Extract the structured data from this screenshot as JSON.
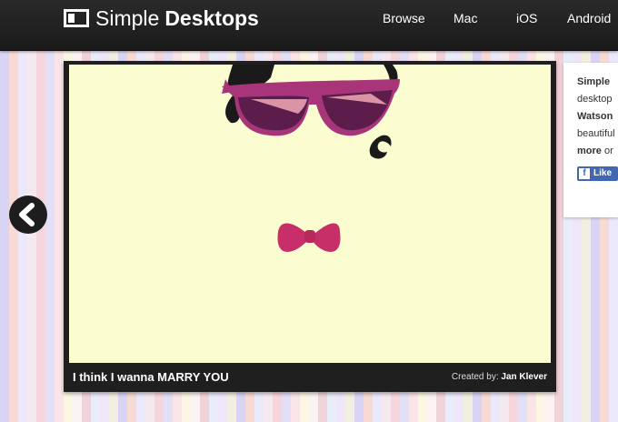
{
  "site": {
    "logo_light": "Simple",
    "logo_bold": "Desktops"
  },
  "nav": [
    {
      "label": "Browse"
    },
    {
      "label": "Mac"
    },
    {
      "label": "iOS"
    },
    {
      "label": "Android"
    }
  ],
  "wallpaper": {
    "title": "I think I wanna MARRY YOU",
    "credit_prefix": "Created by:",
    "credit_author": "Jan Klever"
  },
  "sidebar": {
    "line1": "Simple ",
    "line2": "desktop",
    "line3": "Watson",
    "line4": "beautiful",
    "line5_bold": "more",
    "line5_rest": " or",
    "like_label": "Like"
  },
  "colors": {
    "topbar": "#1f1f1f",
    "wallpaper_bg": "#fbfdd1",
    "glasses": "#a8347a",
    "lens": "#5c1d4b",
    "bowtie": "#c72f68",
    "hair": "#1a1a1a"
  },
  "icons": {
    "prev": "chevron-left-icon",
    "logo": "desktop-icon",
    "facebook": "facebook-icon"
  }
}
